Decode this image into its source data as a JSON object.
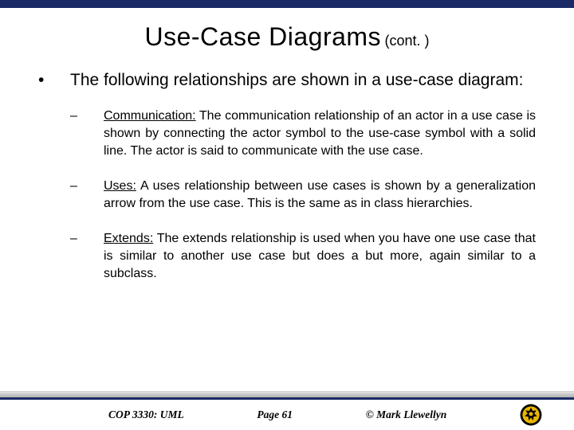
{
  "title": {
    "main": "Use-Case Diagrams",
    "cont": "(cont. )"
  },
  "intro": "The following relationships are shown in a use-case diagram:",
  "items": [
    {
      "head": "Communication:",
      "body": " The communication relationship of an actor in a use case is shown by connecting the actor symbol to the use-case symbol with a solid line.  The actor is said to communicate with the use case."
    },
    {
      "head": "Uses:",
      "body": "  A uses relationship between use cases is shown by a generalization arrow from the use case.  This is the same as in class hierarchies."
    },
    {
      "head": "Extends:",
      "body": " The extends relationship is used when you have one use case that is similar to another use case but does a but more, again similar to a subclass."
    }
  ],
  "footer": {
    "course": "COP 3330:  UML",
    "page": "Page 61",
    "copyright": "© Mark Llewellyn"
  }
}
